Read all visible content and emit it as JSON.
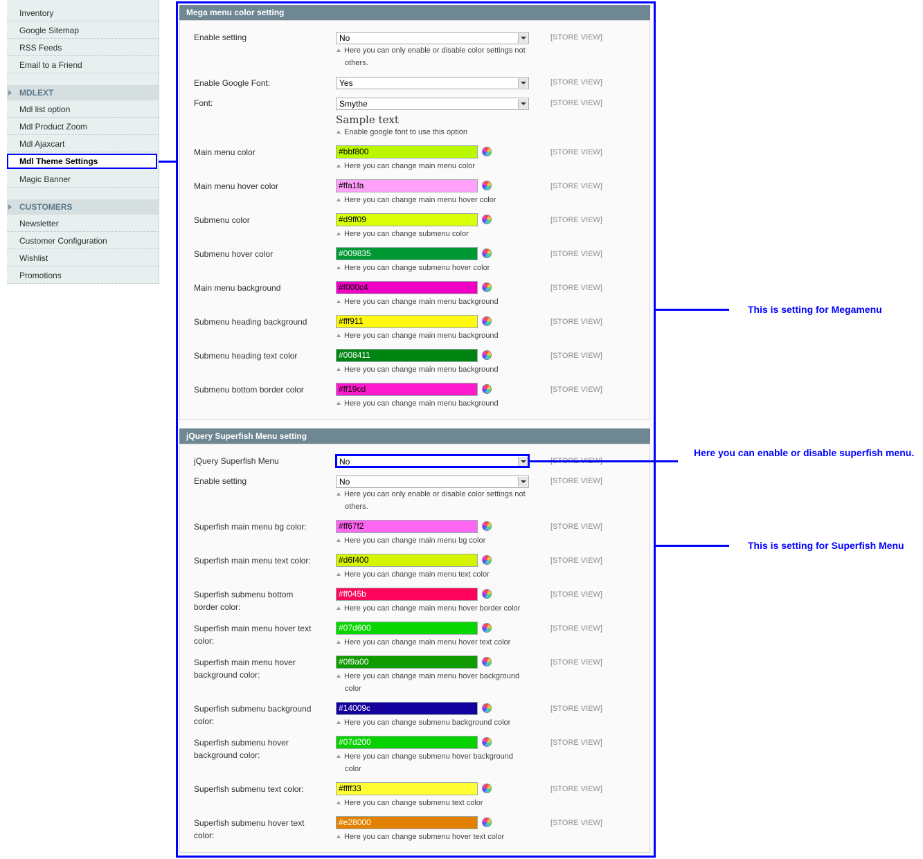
{
  "sidebar": {
    "items_top": [
      "Inventory",
      "Google Sitemap",
      "RSS Feeds",
      "Email to a Friend"
    ],
    "section_mdlext": "MDLEXT",
    "items_mdlext": [
      "Mdl list option",
      "Mdl Product Zoom",
      "Mdl Ajaxcart",
      "Mdl Theme Settings",
      "Magic Banner"
    ],
    "section_customers": "CUSTOMERS",
    "items_customers": [
      "Newsletter",
      "Customer Configuration",
      "Wishlist",
      "Promotions"
    ]
  },
  "scope_label": "[STORE VIEW]",
  "mega": {
    "title": "Mega menu color setting",
    "enable_label": "Enable setting",
    "enable_value": "No",
    "enable_hint_1": "Here you can only enable or disable color settings not",
    "enable_hint_2": "others.",
    "google_font_label": "Enable Google Font:",
    "google_font_value": "Yes",
    "font_label": "Font:",
    "font_value": "Smythe",
    "sample_text": "Sample text",
    "font_hint": "Enable google font to use this option",
    "colors": [
      {
        "label": "Main menu color",
        "value": "#bbf800",
        "hint": "Here you can change main menu color",
        "color": "#bbf800",
        "text_color": "#000000"
      },
      {
        "label": "Main menu hover color",
        "value": "#ffa1fa",
        "hint": "Here you can change main menu hover color",
        "color": "#ffa1fa",
        "text_color": "#000000"
      },
      {
        "label": "Submenu color",
        "value": "#d9ff09",
        "hint": "Here you can change submenu color",
        "color": "#d9ff09",
        "text_color": "#000000"
      },
      {
        "label": "Submenu hover color",
        "value": "#009835",
        "hint": "Here you can change submenu hover color",
        "color": "#009835",
        "text_color": "#ffffff"
      },
      {
        "label": "Main menu background",
        "value": "#f000c4",
        "hint": "Here you can change main menu background",
        "color": "#f000c4",
        "text_color": "#000000"
      },
      {
        "label": "Submenu heading background",
        "value": "#fff911",
        "hint": "Here you can change main menu background",
        "color": "#fff911",
        "text_color": "#000000"
      },
      {
        "label": "Submenu heading text color",
        "value": "#008411",
        "hint": "Here you can change main menu background",
        "color": "#008411",
        "text_color": "#ffffff"
      },
      {
        "label": "Submenu bottom border color",
        "value": "#ff19cd",
        "hint": "Here you can change main menu background",
        "color": "#ff19cd",
        "text_color": "#000000"
      }
    ]
  },
  "superfish": {
    "title": "jQuery Superfish Menu setting",
    "menu_label": "jQuery Superfish Menu",
    "menu_value": "No",
    "enable_label": "Enable setting",
    "enable_value": "No",
    "enable_hint_1": "Here you can only enable or disable color settings not",
    "enable_hint_2": "others.",
    "colors": [
      {
        "label_1": "Superfish main menu bg color:",
        "label_2": "",
        "value": "#ff67f2",
        "hint_1": "Here you can change main menu bg color",
        "hint_2": "",
        "color": "#ff67f2",
        "text_color": "#000000"
      },
      {
        "label_1": "Superfish main menu text color:",
        "label_2": "",
        "value": "#d6f400",
        "hint_1": "Here you can change main menu text color",
        "hint_2": "",
        "color": "#d6f400",
        "text_color": "#000000"
      },
      {
        "label_1": "Superfish submenu bottom",
        "label_2": "border color:",
        "value": "#ff045b",
        "hint_1": "Here you can change main menu hover border color",
        "hint_2": "",
        "color": "#ff045b",
        "text_color": "#ffffff"
      },
      {
        "label_1": "Superfish main menu hover text",
        "label_2": "color:",
        "value": "#07d600",
        "hint_1": "Here you can change main menu hover text color",
        "hint_2": "",
        "color": "#07d600",
        "text_color": "#ffffff"
      },
      {
        "label_1": "Superfish main menu hover",
        "label_2": "background color:",
        "value": "#0f9a00",
        "hint_1": "Here you can change main menu hover background",
        "hint_2": "color",
        "color": "#0f9a00",
        "text_color": "#ffffff"
      },
      {
        "label_1": "Superfish submenu background",
        "label_2": "color:",
        "value": "#14009c",
        "hint_1": "Here you can change submenu background color",
        "hint_2": "",
        "color": "#14009c",
        "text_color": "#ffffff"
      },
      {
        "label_1": "Superfish submenu hover",
        "label_2": "background color:",
        "value": "#07d200",
        "hint_1": "Here you can change submenu hover background",
        "hint_2": "color",
        "color": "#07d200",
        "text_color": "#ffffff"
      },
      {
        "label_1": "Superfish submenu text color:",
        "label_2": "",
        "value": "#ffff33",
        "hint_1": "Here you can change submenu text color",
        "hint_2": "",
        "color": "#ffff33",
        "text_color": "#000000"
      },
      {
        "label_1": "Superfish submenu hover text",
        "label_2": "color:",
        "value": "#e28000",
        "hint_1": "Here you can change submenu hover text color",
        "hint_2": "",
        "color": "#e28000",
        "text_color": "#ffffff"
      }
    ]
  },
  "annotations": {
    "megamenu_note": "This is setting for Megamenu",
    "superfish_toggle_note": "Here you can enable or disable superfish menu.",
    "superfish_note": "This is setting for Superfish Menu"
  }
}
